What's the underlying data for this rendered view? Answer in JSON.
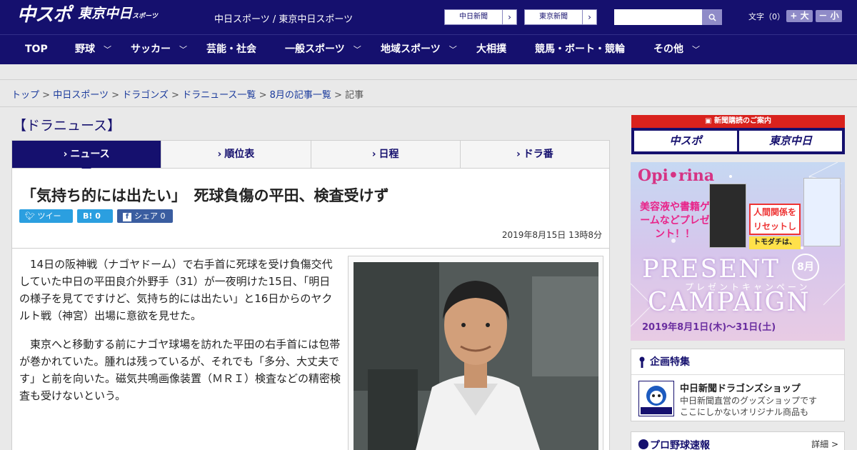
{
  "header": {
    "logo_main": "中スポ",
    "logo_sub": "東京中日",
    "logo_sub_small": "スポーツ",
    "site_names": "中日スポーツ / 東京中日スポーツ",
    "paper_links": [
      "中日新聞",
      "東京新聞"
    ],
    "search_placeholder": "",
    "font_label": "文字（0）",
    "font_larger": "+ 大",
    "font_smaller": "－ 小"
  },
  "nav": {
    "items": [
      {
        "label": "TOP",
        "dropdown": false
      },
      {
        "label": "野球",
        "dropdown": true
      },
      {
        "label": "サッカー",
        "dropdown": true
      },
      {
        "label": "芸能・社会",
        "dropdown": false
      },
      {
        "label": "一般スポーツ",
        "dropdown": true
      },
      {
        "label": "地域スポーツ",
        "dropdown": true
      },
      {
        "label": "大相撲",
        "dropdown": false
      },
      {
        "label": "競馬・ボート・競輪",
        "dropdown": false
      },
      {
        "label": "その他",
        "dropdown": true
      }
    ]
  },
  "breadcrumb": {
    "links": [
      "トップ",
      "中日スポーツ",
      "ドラゴンズ",
      "ドラニュース一覧",
      "8月の記事一覧"
    ],
    "separator": ">",
    "current": "記事"
  },
  "section_title": "【ドラニュース】",
  "tabs": [
    {
      "label": "ニュース",
      "active": true
    },
    {
      "label": "順位表",
      "active": false
    },
    {
      "label": "日程",
      "active": false
    },
    {
      "label": "ドラ番",
      "active": false
    }
  ],
  "article": {
    "title": "「気持ち的には出たい」　死球負傷の平田、検査受けず",
    "share": {
      "tweet": "ツイート",
      "hatena": "B! 0",
      "facebook": "シェア 0"
    },
    "date": "2019年8月15日 13時8分",
    "paragraphs": [
      "14日の阪神戦（ナゴヤドーム）で右手首に死球を受け負傷交代していた中日の平田良介外野手（31）が一夜明けた15日、「明日の様子を見てですけど、気持ち的には出たい」と16日からのヤクルト戦（神宮）出場に意欲を見せた。",
      "東京へと移動する前にナゴヤ球場を訪れた平田の右手首には包帯が巻かれていた。腫れは残っているが、それでも「多分、大丈夫です」と前を向いた。磁気共鳴画像装置（ＭＲＩ）検査などの精密検査も受けないという。"
    ]
  },
  "sidebar": {
    "subscription": {
      "head": "新聞購読のご案内",
      "btn1": "中スポ",
      "btn2": "東京中日"
    },
    "ad": {
      "logo": "Opi•rina",
      "promo": "美容液や書籍ゲームなどプレゼント！！",
      "present": "PRESENT",
      "month": "8月",
      "kana": "プレゼントキャンペーン",
      "campaign": "CAMPAIGN",
      "dates": "2019年8月1日(木)〜31日(土)",
      "book_red": "人間関係をリセットして",
      "book_yellow": "トモダチは、"
    },
    "feature": {
      "head": "企画特集",
      "title": "中日新聞ドラゴンズショップ",
      "desc1": "中日新聞直営のグッズショップです",
      "desc2": "ここにしかないオリジナル商品も"
    },
    "pro": {
      "head": "プロ野球速報",
      "more": "詳細 >"
    }
  },
  "colors": {
    "brand": "#15106e",
    "accent": "#8f8bc8",
    "share_twitter": "#2b9fe0",
    "share_fb": "#3a5da0"
  }
}
